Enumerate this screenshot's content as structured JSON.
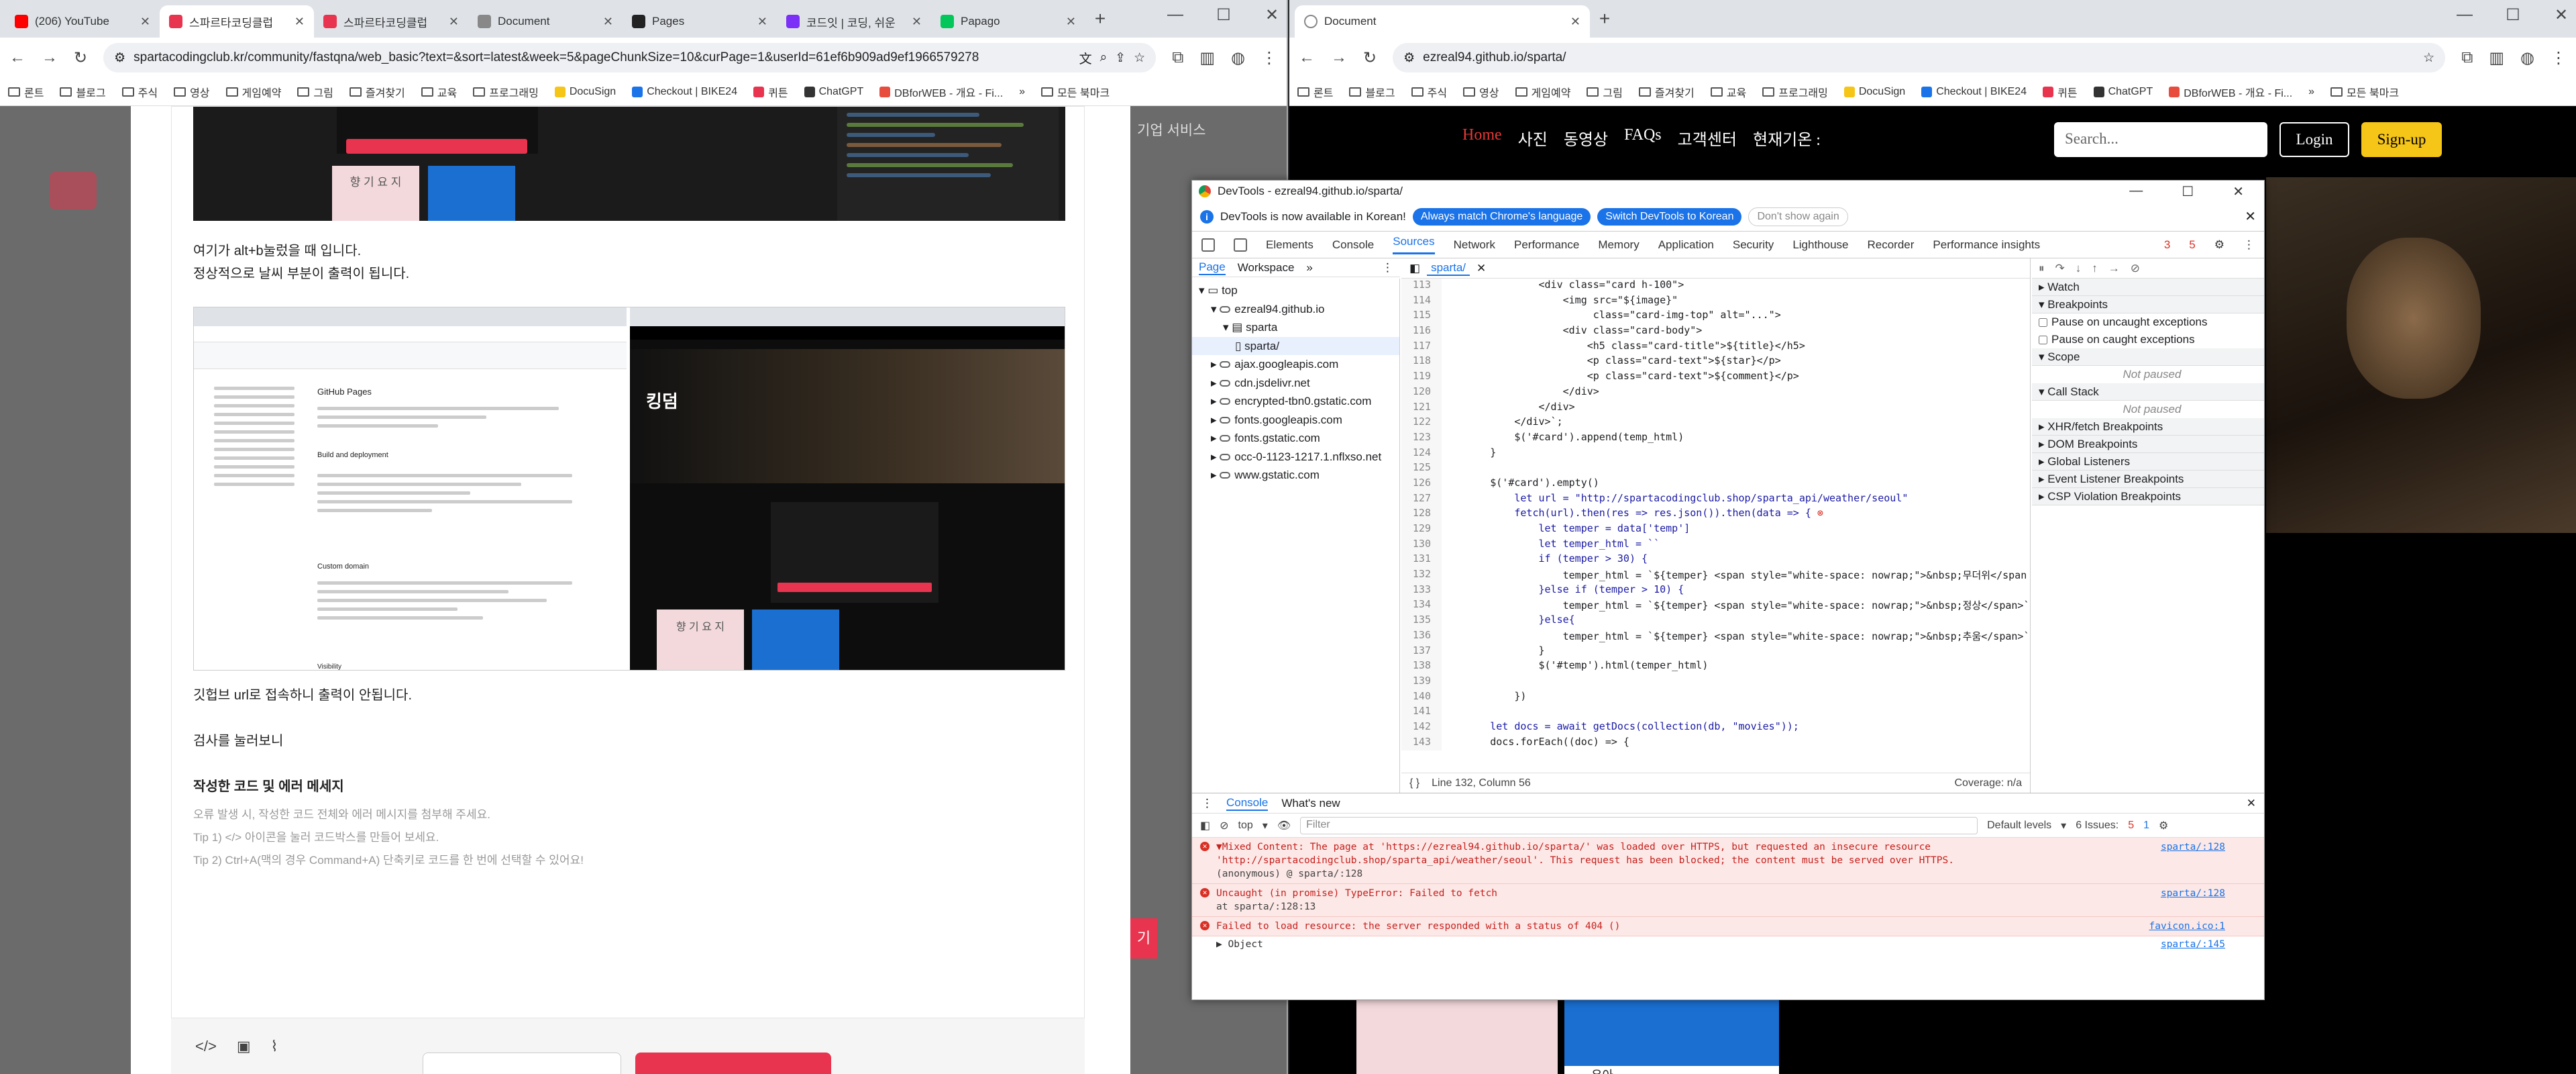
{
  "left": {
    "tabs": [
      {
        "title": "(206) YouTube",
        "color": "#ff0000"
      },
      {
        "title": "스파르타코딩클럽",
        "color": "#e8344e"
      },
      {
        "title": "스파르타코딩클럽",
        "color": "#e8344e"
      },
      {
        "title": "Document",
        "color": "#888888"
      },
      {
        "title": "Pages",
        "color": "#222222"
      },
      {
        "title": "코드잇 | 코딩, 쉬운",
        "color": "#7b2ff7"
      },
      {
        "title": "Papago",
        "color": "#03c75a"
      }
    ],
    "url": "spartacodingclub.kr/community/fastqna/web_basic?text=&sort=latest&week=5&pageChunkSize=10&curPage=1&userId=61ef6b909ad9ef1966579278",
    "bookmarks": [
      "론트",
      "블로그",
      "주식",
      "영상",
      "게임예약",
      "그림",
      "즐겨찾기",
      "교육",
      "프로그래밍",
      "DocuSign",
      "Checkout | BIKE24",
      "퀴튼",
      "ChatGPT",
      "DBforWEB - 개요 - Fi..."
    ],
    "other_bookmarks": "모든 북마크",
    "side_label": "기업 서비스",
    "side_label2": "기",
    "p1": "여기가 alt+b눌렀을 때 입니다.",
    "p2": "정상적으로 날씨 부분이 출력이 됩니다.",
    "shot1_label_a": "향 기 요 지",
    "shot2_title": "킹덤",
    "shot2_left_title": "GitHub Pages",
    "shot2_left_sub": "Build and deployment",
    "shot2_left_sub2": "Custom domain",
    "shot2_left_sub3": "Visibility",
    "p3": "깃헙브 url로 접속하니 출력이 안됩니다.",
    "p4": "검사를 눌러보니",
    "h_section": "작성한 코드 및 에러 메세지",
    "hint1": "오류 발생 시, 작성한 코드 전체와 에러 메시지를 첨부해 주세요.",
    "hint2": "Tip 1) </> 아이콘을 눌러 코드박스를 만들어 보세요.",
    "hint3": "Tip 2) Ctrl+A(맥의 경우 Command+A) 단축키로 코드를 한 번에 선택할 수 있어요!",
    "footer_icons": [
      "code-icon",
      "image-icon",
      "attach-icon"
    ]
  },
  "right": {
    "tab_title": "Document",
    "url": "ezreal94.github.io/sparta/",
    "bookmarks": [
      "론트",
      "블로그",
      "주식",
      "영상",
      "게임예약",
      "그림",
      "즐겨찾기",
      "교육",
      "프로그래밍",
      "DocuSign",
      "Checkout | BIKE24",
      "퀴튼",
      "ChatGPT",
      "DBforWEB - 개요 - Fi..."
    ],
    "other_bookmarks": "모든 북마크",
    "nav": [
      "Home",
      "사진",
      "동영상",
      "FAQs",
      "고객센터",
      "현재기온 :"
    ],
    "search_placeholder": "Search...",
    "login": "Login",
    "signup": "Sign-up",
    "card_text": "우아"
  },
  "devtools": {
    "title": "DevTools - ezreal94.github.io/sparta/",
    "info": "DevTools is now available in Korean!",
    "info_btn1": "Always match Chrome's language",
    "info_btn2": "Switch DevTools to Korean",
    "info_btn3": "Don't show again",
    "tabs": [
      "Elements",
      "Console",
      "Sources",
      "Network",
      "Performance",
      "Memory",
      "Application",
      "Security",
      "Lighthouse",
      "Recorder",
      "Performance insights"
    ],
    "active_tab": "Sources",
    "err_count": "3",
    "warn_count": "5",
    "nav_tabs": [
      "Page",
      "Workspace"
    ],
    "tree": [
      {
        "label": "top",
        "indent": 0,
        "kind": "frame"
      },
      {
        "label": "ezreal94.github.io",
        "indent": 1,
        "kind": "cloud"
      },
      {
        "label": "sparta",
        "indent": 2,
        "kind": "folder"
      },
      {
        "label": "sparta/",
        "indent": 3,
        "kind": "file"
      },
      {
        "label": "ajax.googleapis.com",
        "indent": 1,
        "kind": "cloud"
      },
      {
        "label": "cdn.jsdelivr.net",
        "indent": 1,
        "kind": "cloud"
      },
      {
        "label": "encrypted-tbn0.gstatic.com",
        "indent": 1,
        "kind": "cloud"
      },
      {
        "label": "fonts.googleapis.com",
        "indent": 1,
        "kind": "cloud"
      },
      {
        "label": "fonts.gstatic.com",
        "indent": 1,
        "kind": "cloud"
      },
      {
        "label": "occ-0-1123-1217.1.nflxso.net",
        "indent": 1,
        "kind": "cloud"
      },
      {
        "label": "www.gstatic.com",
        "indent": 1,
        "kind": "cloud"
      }
    ],
    "editor_tab": "sparta/",
    "code": [
      {
        "n": "113",
        "t": "                <div class=\"card h-100\">"
      },
      {
        "n": "114",
        "t": "                    <img src=\"${image}\""
      },
      {
        "n": "115",
        "t": "                         class=\"card-img-top\" alt=\"...\">"
      },
      {
        "n": "116",
        "t": "                    <div class=\"card-body\">"
      },
      {
        "n": "117",
        "t": "                        <h5 class=\"card-title\">${title}</h5>"
      },
      {
        "n": "118",
        "t": "                        <p class=\"card-text\">${star}</p>"
      },
      {
        "n": "119",
        "t": "                        <p class=\"card-text\">${comment}</p>"
      },
      {
        "n": "120",
        "t": "                    </div>"
      },
      {
        "n": "121",
        "t": "                </div>"
      },
      {
        "n": "122",
        "t": "            </div>`;"
      },
      {
        "n": "123",
        "t": "            $('#card').append(temp_html)"
      },
      {
        "n": "124",
        "t": "        }"
      },
      {
        "n": "125",
        "t": ""
      },
      {
        "n": "126",
        "t": "        $('#card').empty()"
      },
      {
        "n": "127",
        "t": "            let url = \"http://spartacodingclub.shop/sparta_api/weather/seoul\""
      },
      {
        "n": "128",
        "t": "            fetch(url).then(res => res.json()).then(data => {"
      },
      {
        "n": "129",
        "t": "                let temper = data['temp']"
      },
      {
        "n": "130",
        "t": "                let temper_html = ``"
      },
      {
        "n": "131",
        "t": "                if (temper > 30) {"
      },
      {
        "n": "132",
        "t": "                    temper_html = `${temper} <span style=\"white-space: nowrap;\">&nbsp;무더위</span"
      },
      {
        "n": "133",
        "t": "                }else if (temper > 10) {"
      },
      {
        "n": "134",
        "t": "                    temper_html = `${temper} <span style=\"white-space: nowrap;\">&nbsp;정상</span>`"
      },
      {
        "n": "135",
        "t": "                }else{"
      },
      {
        "n": "136",
        "t": "                    temper_html = `${temper} <span style=\"white-space: nowrap;\">&nbsp;추움</span>`"
      },
      {
        "n": "137",
        "t": "                }"
      },
      {
        "n": "138",
        "t": "                $('#temp').html(temper_html)"
      },
      {
        "n": "139",
        "t": ""
      },
      {
        "n": "140",
        "t": "            })"
      },
      {
        "n": "141",
        "t": ""
      },
      {
        "n": "142",
        "t": "        let docs = await getDocs(collection(db, \"movies\"));"
      },
      {
        "n": "143",
        "t": "        docs.forEach((doc) => {"
      }
    ],
    "status_line": "Line 132, Column 56",
    "coverage": "Coverage: n/a",
    "debugger": {
      "watch": "Watch",
      "breakpoints": "Breakpoints",
      "pause_uncaught": "Pause on uncaught exceptions",
      "pause_caught": "Pause on caught exceptions",
      "scope": "Scope",
      "not_paused": "Not paused",
      "callstack": "Call Stack",
      "more": [
        "XHR/fetch Breakpoints",
        "DOM Breakpoints",
        "Global Listeners",
        "Event Listener Breakpoints",
        "CSP Violation Breakpoints"
      ]
    },
    "drawer_tabs": [
      "Console",
      "What's new"
    ],
    "context": "top",
    "filter_placeholder": "Filter",
    "levels": "Default levels",
    "issues": "6 Issues:",
    "issue_err": "5",
    "issue_info": "1",
    "messages": [
      {
        "text": "▼Mixed Content: The page at 'https://ezreal94.github.io/sparta/' was loaded over HTTPS, but requested an insecure resource 'http://spartacodingclub.shop/sparta_api/weather/seoul'. This request has been blocked; the content must be served over HTTPS.",
        "sub": "(anonymous) @ sparta/:128",
        "src": "sparta/:128"
      },
      {
        "text": "Uncaught (in promise) TypeError: Failed to fetch",
        "sub": "at sparta/:128:13",
        "src": "sparta/:128"
      },
      {
        "text": "Failed to load resource: the server responded with a status of 404 ()",
        "sub": "",
        "src": "favicon.ico:1"
      }
    ],
    "obj": "▶ Object",
    "obj_src": "sparta/:145"
  }
}
